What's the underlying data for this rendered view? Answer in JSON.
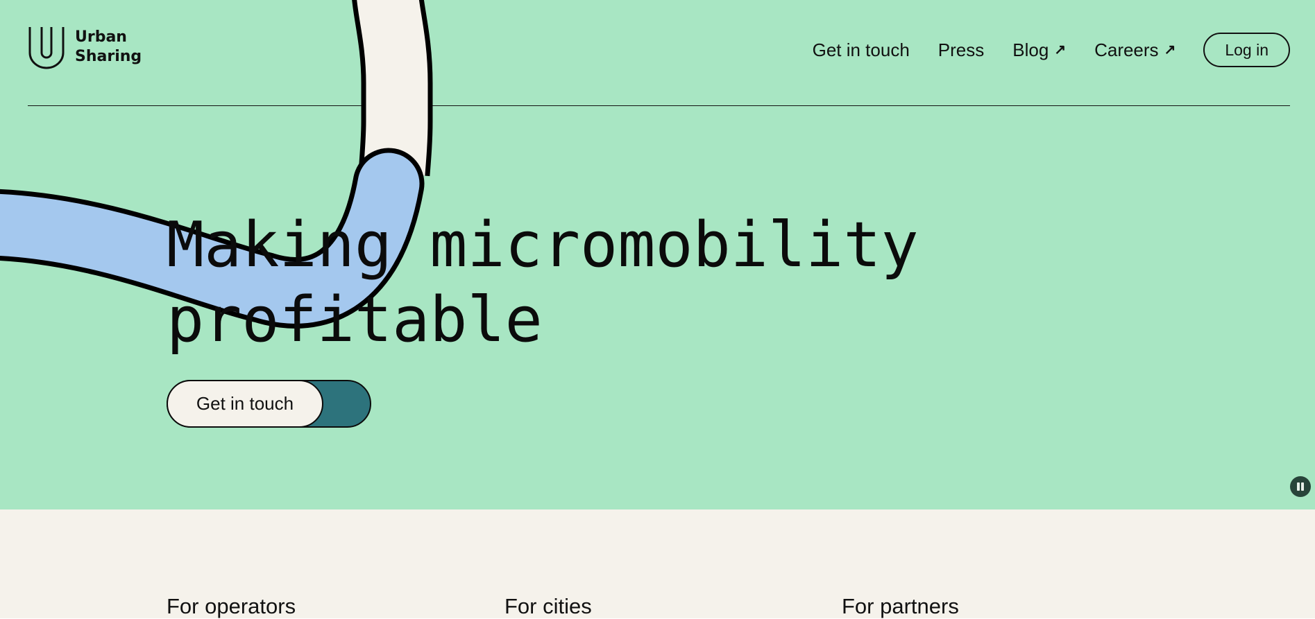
{
  "brand": {
    "name_line1": "Urban",
    "name_line2": "Sharing"
  },
  "nav": {
    "items": [
      {
        "label": "Get in touch",
        "external": false
      },
      {
        "label": "Press",
        "external": false
      },
      {
        "label": "Blog",
        "external": true
      },
      {
        "label": "Careers",
        "external": true
      }
    ],
    "external_arrow": "↗",
    "login_label": "Log in"
  },
  "hero": {
    "headline_line1": "Making micromobility",
    "headline_line2": "profitable",
    "cta_label": "Get in touch",
    "colors": {
      "background": "#a8e6c3",
      "tube_cream": "#f5f2eb",
      "tube_blue": "#a4c8ee",
      "cta_teal": "#2d737c"
    }
  },
  "sections": {
    "operators": "For operators",
    "cities": "For cities",
    "partners": "For partners"
  }
}
